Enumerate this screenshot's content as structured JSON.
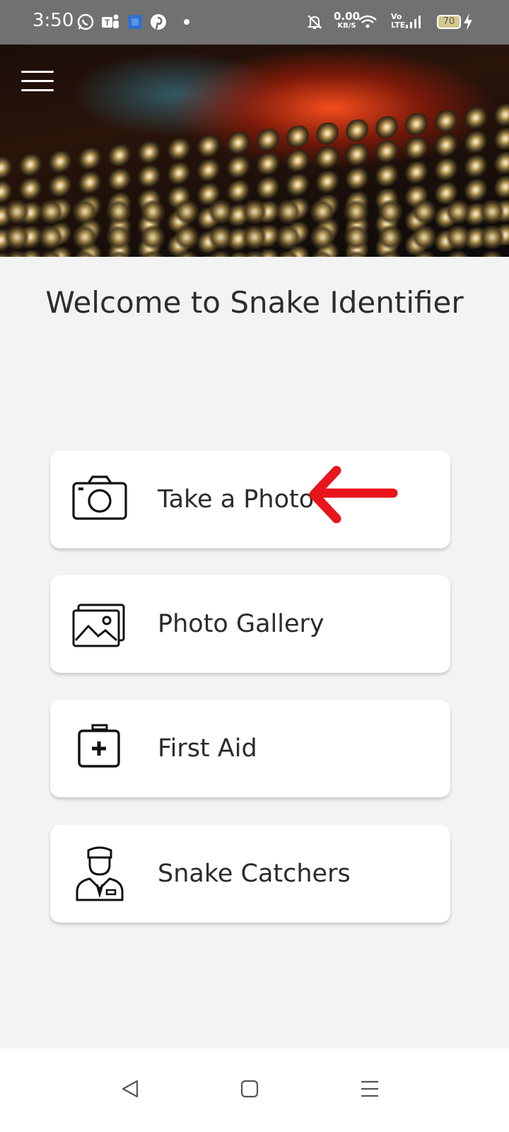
{
  "status_bar": {
    "time": "3:50",
    "net_speed_value": "0.00",
    "net_speed_unit": "KB/S",
    "volte_top": "Vo",
    "volte_bottom": "LTE",
    "battery": "70",
    "icons": [
      "whatsapp-icon",
      "teams-icon",
      "app-icon",
      "pinterest-icon",
      "dot-icon",
      "mute-icon",
      "wifi-icon",
      "signal-icon",
      "battery-icon",
      "charging-icon"
    ]
  },
  "header": {
    "menu_icon": "hamburger-menu-icon",
    "banner": "snake-scales-banner"
  },
  "main": {
    "title": "Welcome to Snake Identifier",
    "cards": [
      {
        "label": "Take a Photo",
        "icon": "camera-icon"
      },
      {
        "label": "Photo Gallery",
        "icon": "gallery-icon"
      },
      {
        "label": "First Aid",
        "icon": "first-aid-kit-icon"
      },
      {
        "label": "Snake Catchers",
        "icon": "catcher-person-icon"
      }
    ],
    "annotation_arrow_color": "#e8151b"
  },
  "nav_bar": {
    "buttons": [
      "back-icon",
      "home-icon",
      "recents-icon"
    ]
  }
}
